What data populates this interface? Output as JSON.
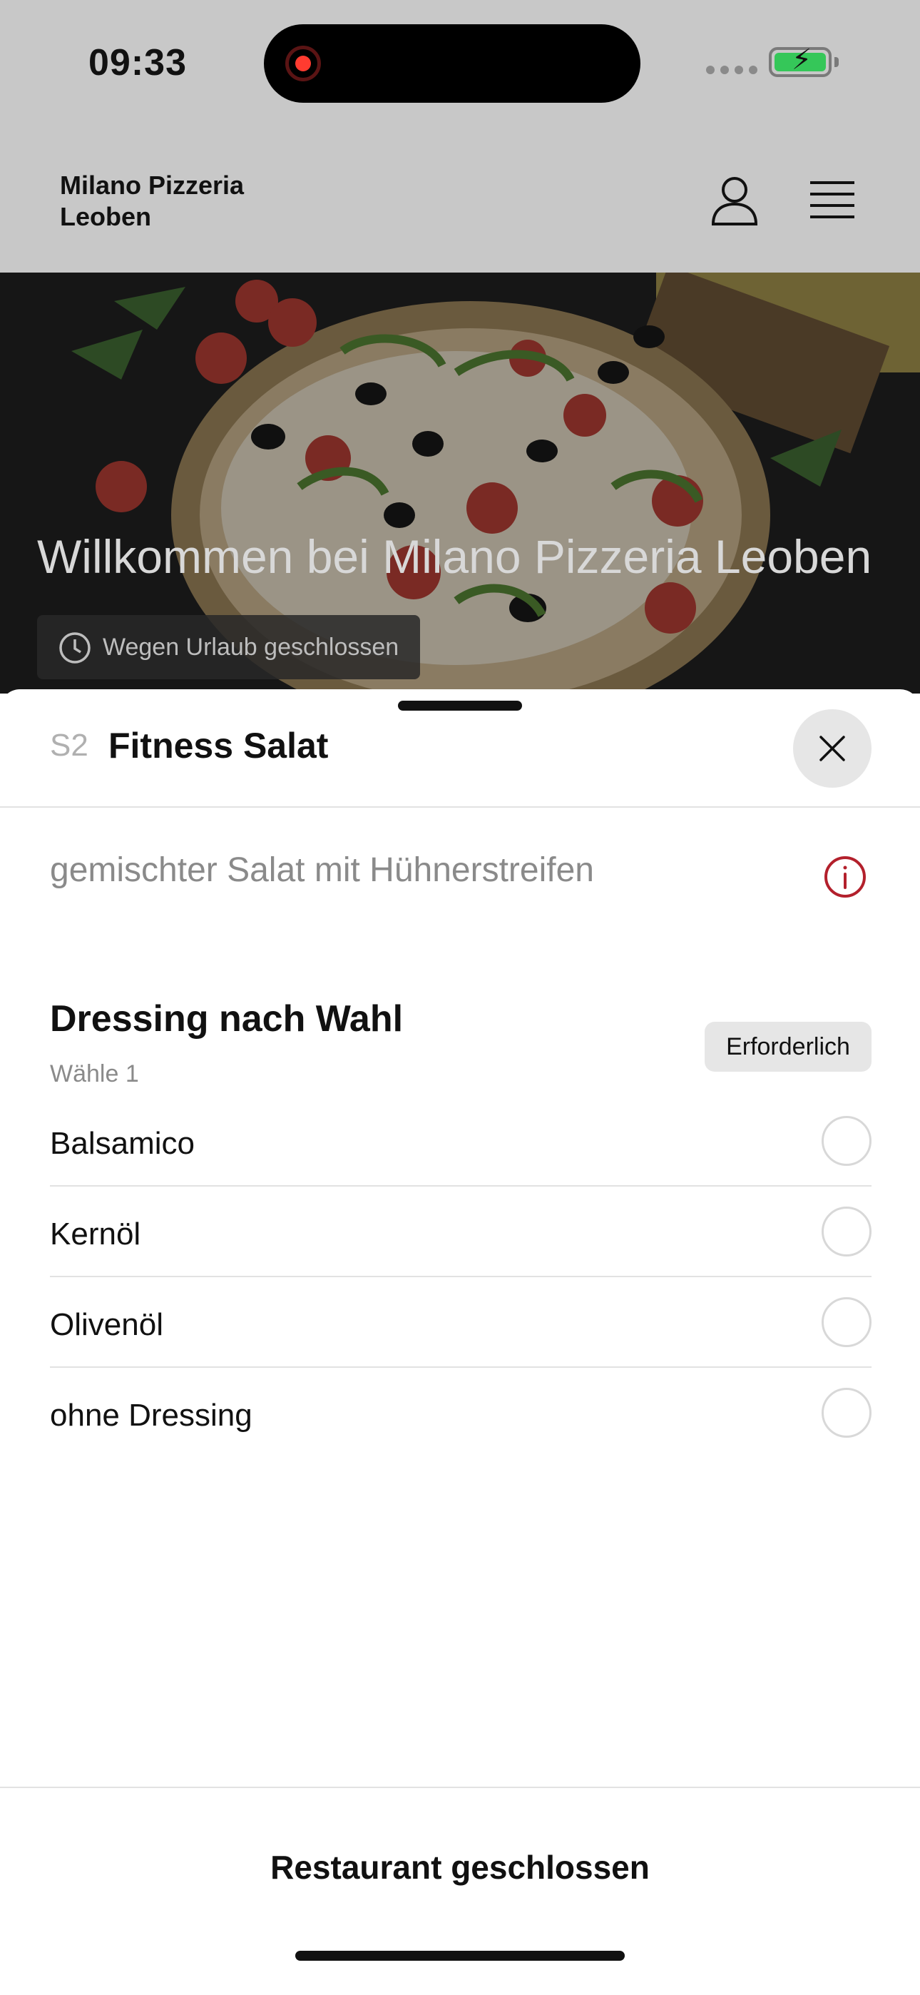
{
  "status_bar": {
    "time": "09:33"
  },
  "app_header": {
    "title": "Milano Pizzeria Leoben",
    "icons": [
      "user-icon",
      "menu-icon"
    ]
  },
  "hero": {
    "title": "Willkommen bei Milano Pizzeria Leoben",
    "status_badge": "Wegen Urlaub geschlossen"
  },
  "sheet": {
    "item_code": "S2",
    "item_name": "Fitness Salat",
    "description": "gemischter Salat mit Hühnerstreifen",
    "option_group": {
      "title": "Dressing nach Wahl",
      "subtitle": "Wähle 1",
      "badge": "Erforderlich",
      "options": [
        {
          "label": "Balsamico",
          "selected": false
        },
        {
          "label": "Kernöl",
          "selected": false
        },
        {
          "label": "Olivenöl",
          "selected": false
        },
        {
          "label": "ohne Dressing",
          "selected": false
        }
      ]
    },
    "footer_label": "Restaurant geschlossen"
  },
  "colors": {
    "accent_red": "#b3202c",
    "dim_overlay": "#c8c8c8",
    "battery_green": "#35c759"
  }
}
